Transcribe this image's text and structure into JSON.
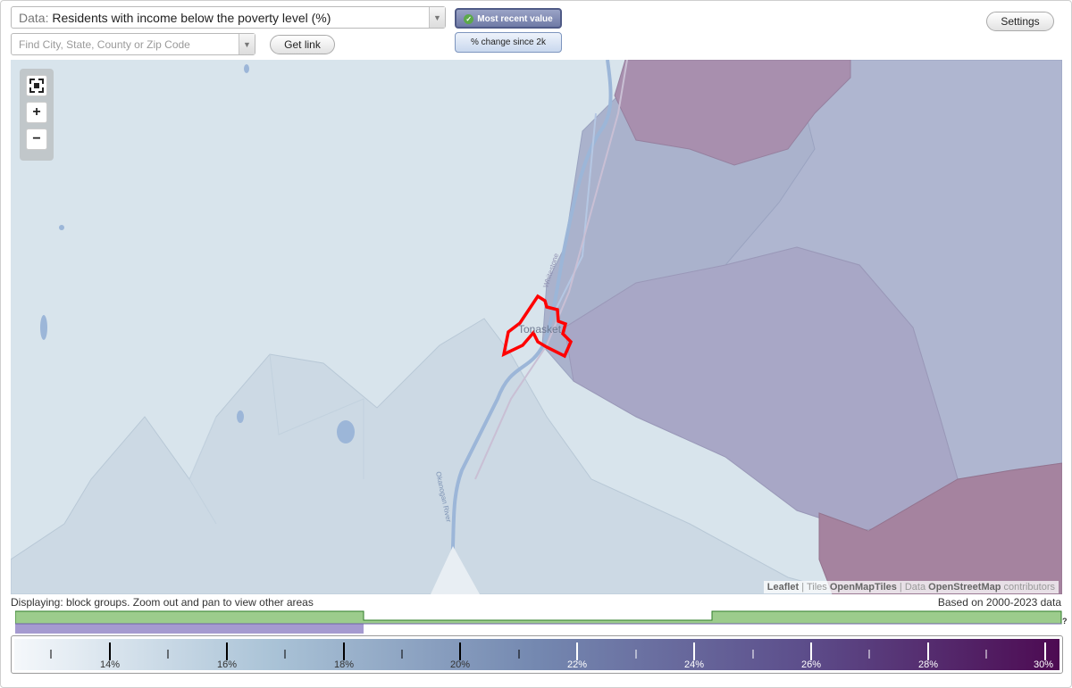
{
  "data_select": {
    "label": "Data:",
    "value": "Residents with income below the poverty level (%)"
  },
  "search": {
    "placeholder": "Find City, State, County or Zip Code"
  },
  "buttons": {
    "get_link": "Get link",
    "settings": "Settings",
    "most_recent": "Most recent value",
    "change_since": "% change since 2k"
  },
  "map": {
    "place_label": "Tonasket",
    "road_label": "Whitestone",
    "river_label": "Okanogan River"
  },
  "attribution": {
    "leaflet": "Leaflet",
    "sep1": "|",
    "tiles_prefix": "Tiles",
    "tiles": "OpenMapTiles",
    "sep2": "|",
    "data_prefix": "Data",
    "data": "OpenStreetMap",
    "suffix": "contributors"
  },
  "notes": {
    "displaying": "Displaying: block groups. Zoom out and pan to view other areas",
    "based_on": "Based on 2000-2023 data"
  },
  "timeline": {
    "help": "?"
  },
  "legend": {
    "ticks": [
      "14%",
      "16%",
      "18%",
      "20%",
      "22%",
      "24%",
      "26%",
      "28%",
      "30%"
    ]
  },
  "colors": {
    "region_low": "#d7e2ea",
    "region_mid": "#aab2cc",
    "region_high": "#a5839f",
    "highlight": "#ff0000",
    "timeline_green": "#9ccc8c",
    "timeline_purple": "#a59ad0",
    "legend_start": "#f5f8fb",
    "legend_end": "#4d0a52"
  }
}
